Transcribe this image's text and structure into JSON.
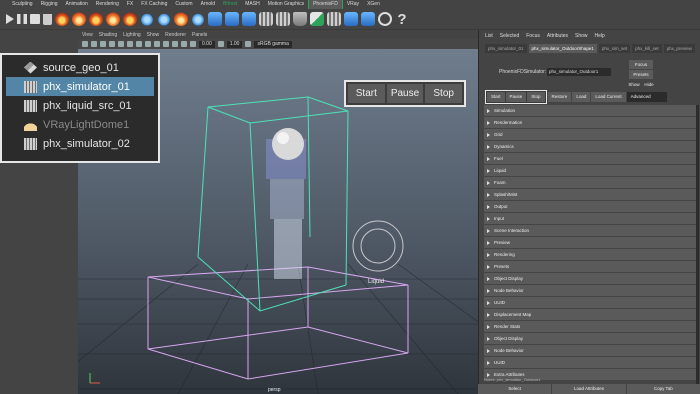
{
  "shelf": {
    "tabs": [
      "Sculpting",
      "Rigging",
      "Animation",
      "Rendering",
      "FX",
      "FX Caching",
      "Custom",
      "Arnold",
      "Bifrost",
      "MASH",
      "Motion Graphics",
      "PhoenixFD",
      "VRay",
      "XGen"
    ],
    "active_tab": "PhoenixFD"
  },
  "viewport": {
    "menu": [
      "View",
      "Shading",
      "Lighting",
      "Show",
      "Renderer",
      "Panels"
    ],
    "field_a": "0.00",
    "field_b": "1.00",
    "colorspace": "sRGB gamma",
    "camera_label": "persp",
    "light_label": "Liquid"
  },
  "outliner": {
    "items": [
      {
        "label": "source_geo_01",
        "icon": "geometry-icon",
        "selected": false,
        "dim": false
      },
      {
        "label": "phx_simulator_01",
        "icon": "phx-simulator-icon",
        "selected": true,
        "dim": false
      },
      {
        "label": "phx_liquid_src_01",
        "icon": "phx-source-icon",
        "selected": false,
        "dim": false
      },
      {
        "label": "VRayLightDome1",
        "icon": "dome-light-icon",
        "selected": false,
        "dim": true
      },
      {
        "label": "phx_simulator_02",
        "icon": "phx-simulator-icon",
        "selected": false,
        "dim": false
      }
    ]
  },
  "sim_controls": {
    "start": "Start",
    "pause": "Pause",
    "stop": "Stop"
  },
  "attribute_editor": {
    "menu": [
      "List",
      "Selected",
      "Focus",
      "Attributes",
      "Show",
      "Help"
    ],
    "tabs": [
      "phx_simulator_01",
      "phx_simulator_OutdoorShape1",
      "phx_sim_set",
      "phx_kill_set",
      "phx_preview"
    ],
    "active_tab": "phx_simulator_OutdoorShape1",
    "node_label": "PhoenixFDSimulator:",
    "node_value": "phx_simulator_Outdoor1",
    "side_buttons": {
      "focus": "Focus",
      "presets": "Presets",
      "show": "Show",
      "hide": "Hide"
    },
    "sim_buttons": {
      "start": "Start",
      "pause": "Pause",
      "stop": "Stop",
      "restore": "Restore",
      "load": "Load",
      "load_current": "Load Current"
    },
    "mode": "Advanced",
    "rollouts": [
      "Simulation",
      "Rendermation",
      "Grid",
      "Dynamics",
      "Fuel",
      "Liquid",
      "Foam",
      "Splash/Mist",
      "Output",
      "Input",
      "Scene Interaction",
      "Preview",
      "Rendering",
      "Presets",
      "Object Display",
      "Node Behavior",
      "UUID",
      "Displacement Map",
      "Render Stats",
      "Object Display",
      "Node Behavior",
      "UUID",
      "Extra Attributes"
    ],
    "notes": "Notes:  phx_simulator_Outdoor1",
    "bottom_buttons": {
      "select": "Select",
      "load_attributes": "Load Attributes",
      "copy_tab": "Copy Tab"
    }
  }
}
